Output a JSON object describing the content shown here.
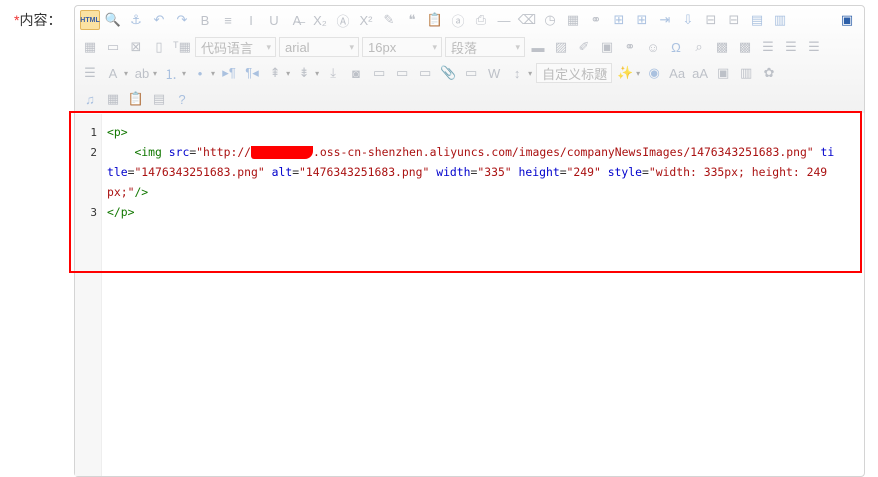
{
  "field": {
    "required_mark": "*",
    "label": "内容："
  },
  "toolbar": {
    "row1": [
      "html",
      "preview",
      "anchor",
      "undo",
      "redo",
      "bold",
      "indent",
      "italic",
      "underline",
      "strikethrough",
      "subscript",
      "fontborder",
      "superscript",
      "formatmatch",
      "blockquote",
      "pasteplain",
      "selectall",
      "print",
      "horizontal",
      "removeformat",
      "time",
      "date",
      "unlink",
      "insertrow",
      "insertcol",
      "mergeright",
      "mergedown",
      "deleterow",
      "deletecol",
      "splittorows",
      "splittocols"
    ],
    "row2_pre": [
      "inserttable",
      "insertparagraph",
      "deletetable",
      "insertparagraphbeforetable",
      "insertcode-title"
    ],
    "selects": {
      "code_language": "代码语言",
      "font_family": "arial",
      "font_size": "16px",
      "paragraph": "段落",
      "custom_title": "自定义标题"
    },
    "row2_post": [
      "simpleupload",
      "insertimage",
      "scrawl",
      "snapscreen",
      "link",
      "emotion",
      "spechars",
      "searchreplace",
      "map",
      "gmap",
      "justifyleft",
      "justifyright",
      "justifycenter"
    ],
    "row3": [
      "justifyjustify",
      "forecolor",
      "backcolor",
      "insertorderedlist",
      "insertunorderedlist",
      "directionalityltr",
      "directionalityrtl",
      "rowspacingtop",
      "rowspacingbottom",
      "pagebreak",
      "insertframe",
      "imagenone",
      "imageleft",
      "imageright",
      "attachment",
      "imagecenter",
      "wordimage",
      "lineheight"
    ],
    "row3_post": [
      "autotypeset",
      "background",
      "touppercase",
      "tolowercase",
      "insertvideo",
      "template",
      "drafts"
    ],
    "row4": [
      "music",
      "insertchart",
      "paste",
      "charts",
      "help"
    ]
  },
  "code": {
    "lines": [
      {
        "num": "1"
      },
      {
        "num": "2"
      },
      {
        "num": ""
      },
      {
        "num": ""
      },
      {
        "num": "3"
      }
    ],
    "l1": "<p>",
    "l2": {
      "indent": "    ",
      "open": "<img ",
      "src_attr": "src",
      "src_val_a": "\"http://",
      "src_val_b": ".oss-cn-shenzhen.aliyuncs.com/images/companyNewsImages/1476343251683.png\"",
      "title_attr_a": " ti"
    },
    "l2b": {
      "title_attr_b": "tle",
      "title_val": "\"1476343251683.png\"",
      "alt_attr": " alt",
      "alt_val": "\"1476343251683.png\"",
      "width_attr": " width",
      "width_val": "\"335\"",
      "height_attr": " height",
      "height_val": "\"249\"",
      "style_attr": " style",
      "style_val": "\"width: 335px; height: 249"
    },
    "l2c": {
      "style_val": "px;\"",
      "close": "/>"
    },
    "l3": "</p>",
    "eq": "="
  }
}
